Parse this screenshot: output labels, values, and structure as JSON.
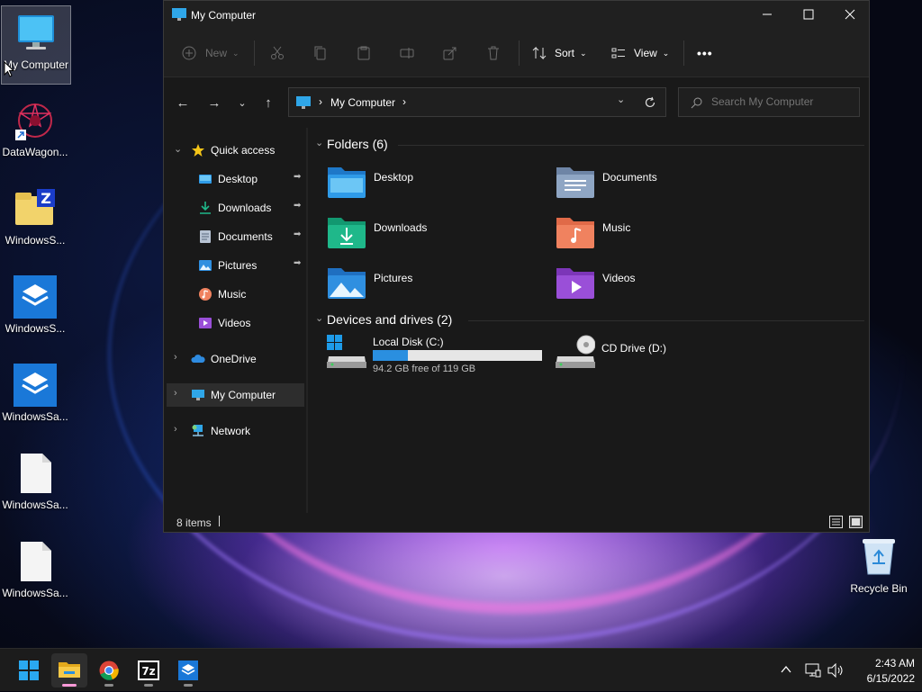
{
  "desktop": {
    "icons": [
      {
        "label": "My Computer"
      },
      {
        "label": "DataWagon..."
      },
      {
        "label": "WindowsS..."
      },
      {
        "label": "WindowsS..."
      },
      {
        "label": "WindowsSa..."
      },
      {
        "label": "WindowsSa..."
      },
      {
        "label": "WindowsSa..."
      }
    ],
    "recycle_bin": {
      "label": "Recycle Bin"
    }
  },
  "window": {
    "title": "My Computer",
    "toolbar": {
      "new_label": "New",
      "sort_label": "Sort",
      "view_label": "View",
      "more_label": "•••"
    },
    "address": {
      "path_label": "My Computer",
      "separator": "›"
    },
    "search": {
      "placeholder": "Search My Computer"
    },
    "nav": {
      "quick_access": "Quick access",
      "items": [
        {
          "label": "Desktop",
          "pinned": true
        },
        {
          "label": "Downloads",
          "pinned": true
        },
        {
          "label": "Documents",
          "pinned": true
        },
        {
          "label": "Pictures",
          "pinned": true
        },
        {
          "label": "Music",
          "pinned": false
        },
        {
          "label": "Videos",
          "pinned": false
        }
      ],
      "onedrive": "OneDrive",
      "my_computer": "My Computer",
      "network": "Network"
    },
    "folders_group": {
      "title": "Folders (6)",
      "items": [
        {
          "label": "Desktop",
          "color": "#2f9be8"
        },
        {
          "label": "Documents",
          "color": "#8fa6c4"
        },
        {
          "label": "Downloads",
          "color": "#1fb88a"
        },
        {
          "label": "Music",
          "color": "#f0825f"
        },
        {
          "label": "Pictures",
          "color": "#2f8fe0"
        },
        {
          "label": "Videos",
          "color": "#9a4fd8"
        }
      ]
    },
    "drives_group": {
      "title": "Devices and drives (2)",
      "local_disk": {
        "label": "Local Disk (C:)",
        "free_text": "94.2 GB free of 119 GB",
        "used_fraction": 0.21
      },
      "cd_drive": {
        "label": "CD Drive (D:)"
      }
    },
    "status": {
      "items_count": "8 items"
    }
  },
  "taskbar": {
    "clock_time": "2:43 AM",
    "clock_date": "6/15/2022",
    "apps": [
      "start-button",
      "file-explorer",
      "chrome",
      "7zip",
      "windows-sandbox"
    ],
    "accent": "#ff9ad8"
  }
}
